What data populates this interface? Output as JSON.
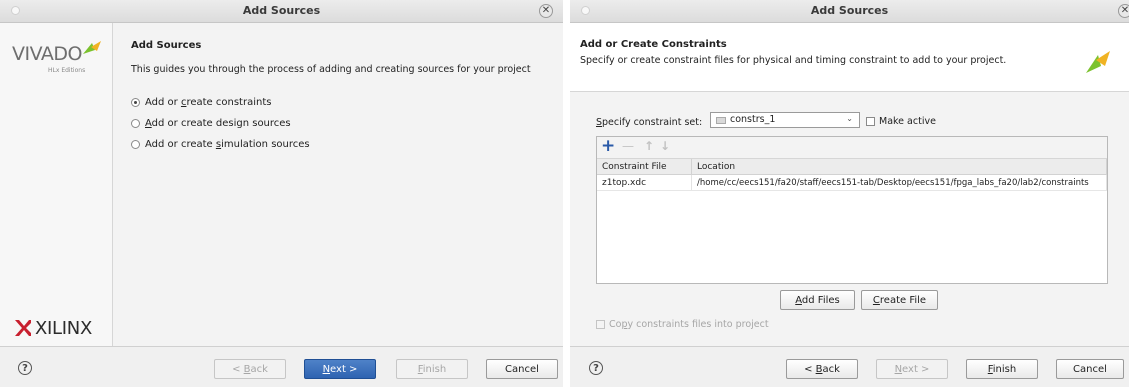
{
  "dialog1": {
    "title": "Add Sources",
    "brand": {
      "logo_text": "VIVADO",
      "logo_sub": "HLx Editions",
      "footer_logo": "XILINX"
    },
    "heading": "Add Sources",
    "description": "This guides you through the process of adding and creating sources for your project",
    "options": [
      {
        "prefix": "Add or ",
        "accel": "c",
        "suffix": "reate constraints",
        "selected": true
      },
      {
        "prefix": "",
        "accel": "A",
        "suffix": "dd or create design sources",
        "selected": false
      },
      {
        "prefix": "Add or create ",
        "accel": "s",
        "suffix": "imulation sources",
        "selected": false
      }
    ],
    "buttons": {
      "back": {
        "prefix": "< ",
        "accel": "B",
        "suffix": "ack"
      },
      "next": {
        "prefix": "",
        "accel": "N",
        "suffix": "ext >"
      },
      "finish": {
        "prefix": "",
        "accel": "F",
        "suffix": "inish"
      },
      "cancel": "Cancel"
    }
  },
  "dialog2": {
    "title": "Add Sources",
    "heading": "Add or Create Constraints",
    "description": "Specify or create constraint files for physical and timing constraint to add to your project.",
    "constraint_set": {
      "label_accel": "S",
      "label_rest": "pecify constraint set:",
      "value": "constrs_1",
      "make_active_label": "Make active",
      "make_active_checked": false
    },
    "toolbar": {
      "add": "+",
      "remove": "—",
      "up": "↑",
      "down": "↓"
    },
    "table": {
      "columns": [
        "Constraint File",
        "Location"
      ],
      "rows": [
        {
          "file": "z1top.xdc",
          "location": "/home/cc/eecs151/fa20/staff/eecs151-tab/Desktop/eecs151/fpga_labs_fa20/lab2/constraints"
        }
      ]
    },
    "add_files": {
      "accel": "A",
      "rest": "dd Files"
    },
    "create_file": {
      "accel": "C",
      "rest": "reate File"
    },
    "copy_checkbox": {
      "prefix": "Co",
      "accel": "p",
      "suffix": "y constraints files into project",
      "checked": false
    },
    "buttons": {
      "back": {
        "prefix": "< ",
        "accel": "B",
        "suffix": "ack"
      },
      "next": {
        "prefix": "",
        "accel": "N",
        "suffix": "ext >"
      },
      "finish": {
        "prefix": "",
        "accel": "F",
        "suffix": "inish"
      },
      "cancel": "Cancel"
    }
  },
  "colors": {
    "primary_button": "#2e63b1",
    "logo_green": "#77b82a",
    "xilinx_red": "#c8202f",
    "selection": "#d7e4f7"
  }
}
